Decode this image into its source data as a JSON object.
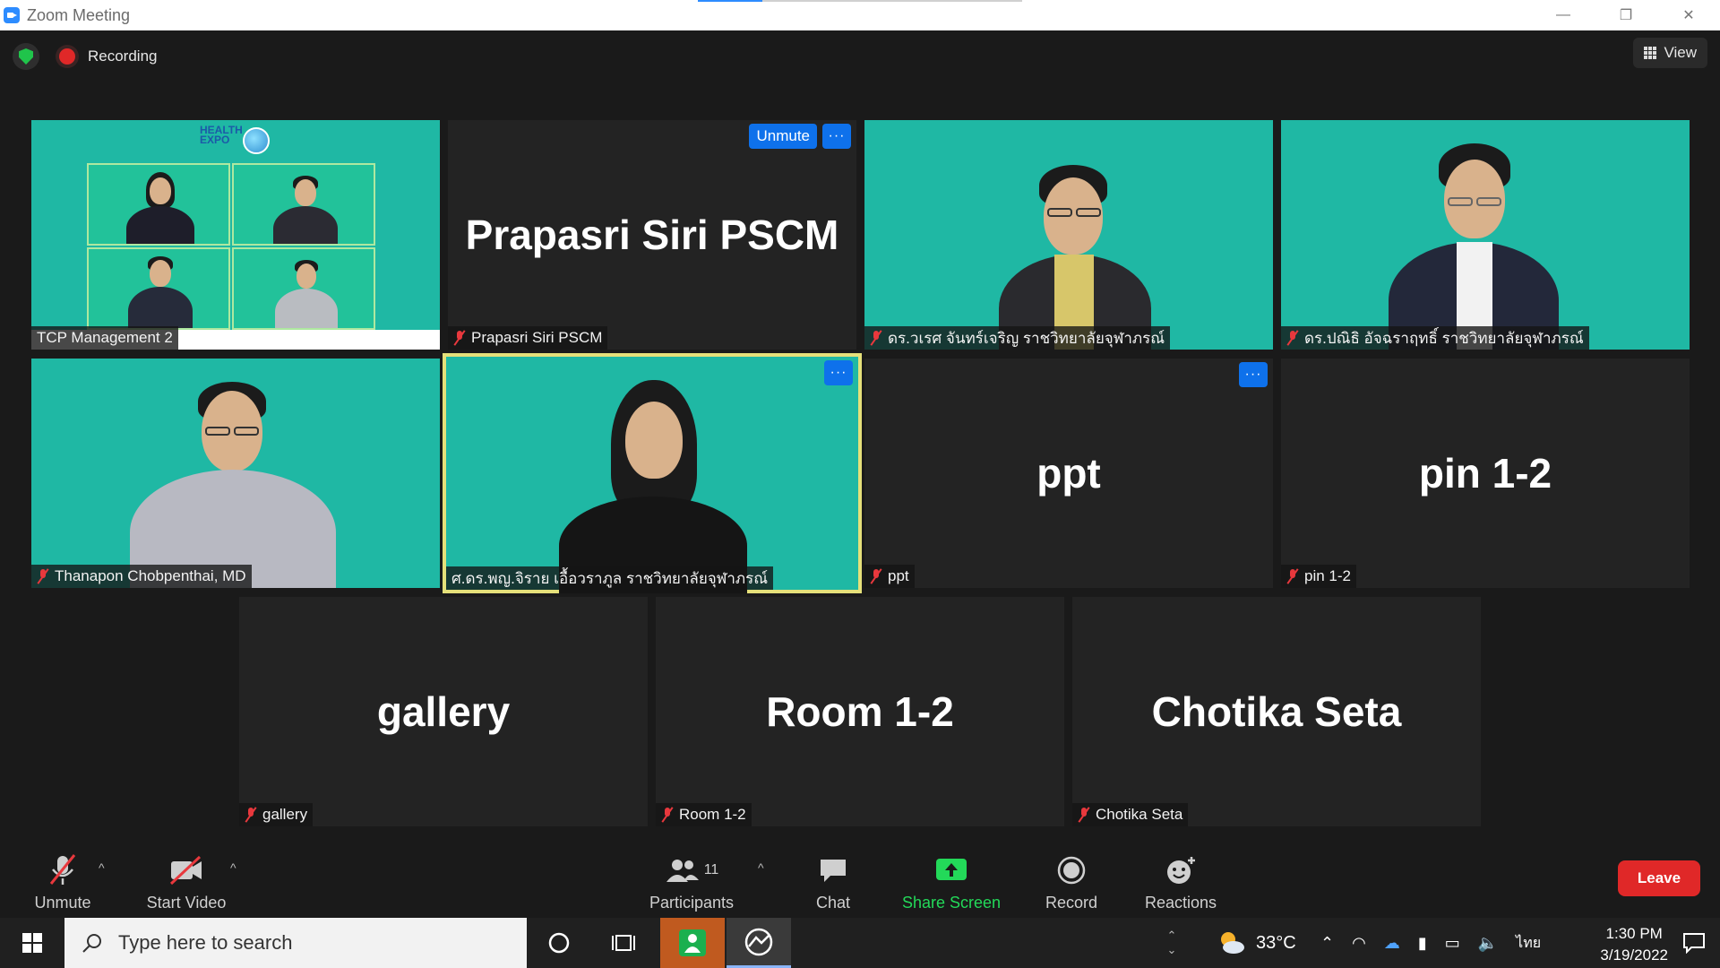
{
  "window": {
    "title": "Zoom Meeting",
    "minimize": "—",
    "restore": "❐",
    "close": "✕"
  },
  "topbar": {
    "recording_label": "Recording",
    "view_label": "View"
  },
  "tiles": [
    {
      "name": "TCP Management 2",
      "muted": false
    },
    {
      "name": "Prapasri Siri PSCM",
      "big": "Prapasri Siri PSCM",
      "unmute_label": "Unmute",
      "more": "···",
      "muted": true
    },
    {
      "name": "ดร.วเรศ จันทร์เจริญ ราชวิทยาลัยจุฬาภรณ์",
      "muted": true
    },
    {
      "name": "ดร.ปณิธิ อัจฉราฤทธิ์ ราชวิทยาลัยจุฬาภรณ์",
      "muted": true
    },
    {
      "name": "Thanapon Chobpenthai, MD",
      "muted": true
    },
    {
      "name": "ศ.ดร.พญ.จิราย เอื้อวราภูล ราชวิทยาลัยจุฬาภรณ์",
      "more": "···",
      "muted": false
    },
    {
      "name": "ppt",
      "big": "ppt",
      "more": "···",
      "muted": true
    },
    {
      "name": "pin 1-2",
      "big": "pin 1-2",
      "muted": true
    },
    {
      "name": "gallery",
      "big": "gallery",
      "muted": true
    },
    {
      "name": "Room 1-2",
      "big": "Room 1-2",
      "muted": true
    },
    {
      "name": "Chotika Seta",
      "big": "Chotika Seta",
      "muted": true
    }
  ],
  "tcp_logo": {
    "line1": "HEALTH",
    "line2": "EXPO"
  },
  "toolbar": {
    "unmute": "Unmute",
    "start_video": "Start Video",
    "participants": "Participants",
    "participants_count": "11",
    "chat": "Chat",
    "share_screen": "Share Screen",
    "record": "Record",
    "reactions": "Reactions",
    "leave": "Leave",
    "caret": "^"
  },
  "taskbar": {
    "search_placeholder": "Type here to search",
    "temperature": "33°C",
    "language": "ไทย",
    "time": "1:30 PM",
    "date": "3/19/2022"
  },
  "colors": {
    "teal_bg": "#1fb8a4",
    "accent_blue": "#0e71eb",
    "leave_red": "#e02828",
    "share_green": "#23d959",
    "speaker_border": "#e5e07a"
  }
}
